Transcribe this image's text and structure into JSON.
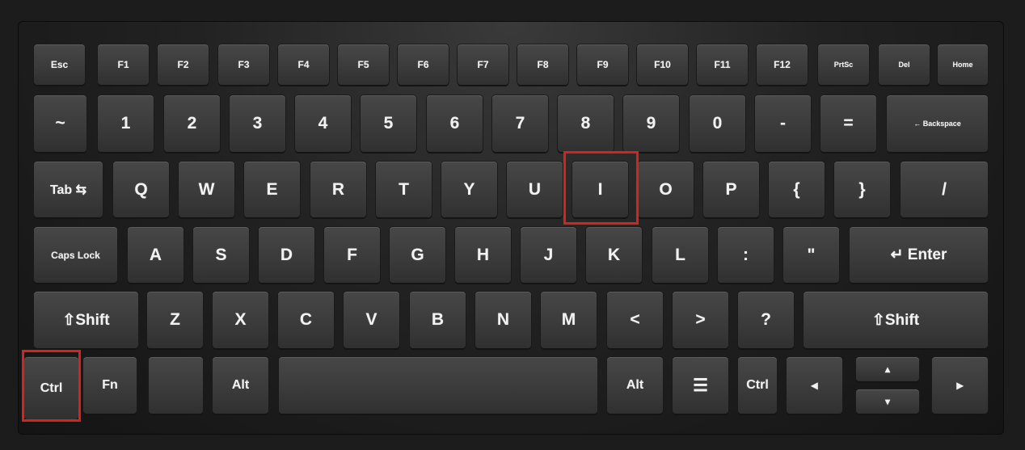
{
  "keyboard": {
    "row0": [
      "Esc",
      "F1",
      "F2",
      "F3",
      "F4",
      "F5",
      "F6",
      "F7",
      "F8",
      "F9",
      "F10",
      "F11",
      "F12",
      "PrtSc",
      "Del",
      "Home"
    ],
    "row1": [
      "~",
      "1",
      "2",
      "3",
      "4",
      "5",
      "6",
      "7",
      "8",
      "9",
      "0",
      "-",
      "=",
      "← Backspace"
    ],
    "row2": [
      "Tab ⇆",
      "Q",
      "W",
      "E",
      "R",
      "T",
      "Y",
      "U",
      "I",
      "O",
      "P",
      "{",
      "}",
      "/"
    ],
    "row3": [
      "Caps Lock",
      "A",
      "S",
      "D",
      "F",
      "G",
      "H",
      "J",
      "K",
      "L",
      ":",
      "\"",
      "↵ Enter"
    ],
    "row4": [
      "⇧Shift",
      "Z",
      "X",
      "C",
      "V",
      "B",
      "N",
      "M",
      "<",
      ">",
      "?",
      "⇧Shift"
    ],
    "row5": [
      "Ctrl",
      "Fn",
      "",
      "Alt",
      "",
      "Alt",
      "☰",
      "Ctrl",
      "◂",
      "▴",
      "▾",
      "▸"
    ]
  },
  "highlights": {
    "colour": "#d9211d",
    "keys": [
      "I",
      "Ctrl"
    ]
  }
}
